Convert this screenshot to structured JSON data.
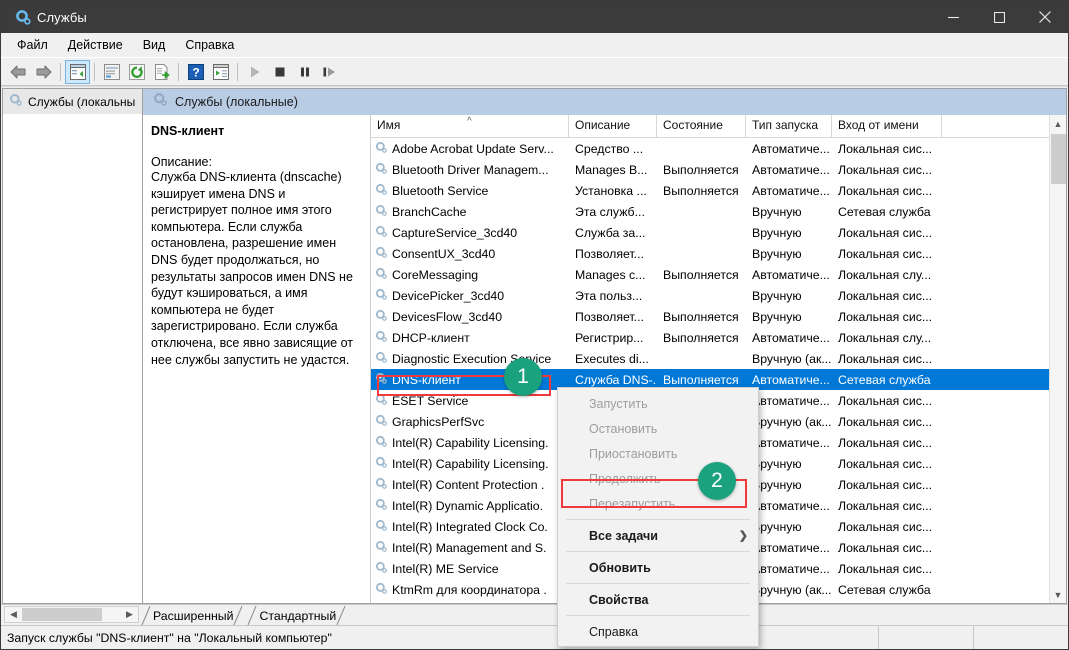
{
  "window": {
    "title": "Службы",
    "icon": "services-gear-icon",
    "controls": {
      "minimize": "minimize-icon",
      "maximize": "maximize-icon",
      "close": "close-icon"
    }
  },
  "menu": {
    "items": [
      "Файл",
      "Действие",
      "Вид",
      "Справка"
    ]
  },
  "toolbar": {
    "buttons": [
      "back-arrow-icon",
      "forward-arrow-icon",
      "show-hide-tree-icon",
      "properties-icon",
      "refresh-icon",
      "export-list-icon",
      "help-icon",
      "show-action-pane-icon",
      "start-service-icon",
      "stop-service-icon",
      "pause-service-icon",
      "restart-service-icon"
    ]
  },
  "tree": {
    "node_label": "Службы (локальны"
  },
  "content": {
    "header_title": "Службы (локальные)",
    "description_panel": {
      "service_name": "DNS-клиент",
      "label": "Описание:",
      "text": "Служба DNS-клиента (dnscache) кэширует имена DNS и регистрирует полное имя этого компьютера. Если служба остановлена, разрешение имен DNS будет продолжаться, но результаты запросов имен DNS не будут кэшироваться, а имя компьютера не будет зарегистрировано. Если служба отключена, все явно зависящие от нее службы запустить не удастся."
    }
  },
  "table": {
    "columns": [
      "Имя",
      "Описание",
      "Состояние",
      "Тип запуска",
      "Вход от имени"
    ],
    "sorted_by": "Имя",
    "sort_direction": "ascending",
    "rows": [
      {
        "name": "Adobe Acrobat Update Serv...",
        "description": "Средство ...",
        "state": "",
        "startup": "Автоматиче...",
        "logon": "Локальная сис...",
        "selected": false
      },
      {
        "name": "Bluetooth Driver Managem...",
        "description": "Manages B...",
        "state": "Выполняется",
        "startup": "Автоматиче...",
        "logon": "Локальная сис...",
        "selected": false
      },
      {
        "name": "Bluetooth Service",
        "description": "Установка ...",
        "state": "Выполняется",
        "startup": "Автоматиче...",
        "logon": "Локальная сис...",
        "selected": false
      },
      {
        "name": "BranchCache",
        "description": "Эта служб...",
        "state": "",
        "startup": "Вручную",
        "logon": "Сетевая служба",
        "selected": false
      },
      {
        "name": "CaptureService_3cd40",
        "description": "Служба за...",
        "state": "",
        "startup": "Вручную",
        "logon": "Локальная сис...",
        "selected": false
      },
      {
        "name": "ConsentUX_3cd40",
        "description": "Позволяет...",
        "state": "",
        "startup": "Вручную",
        "logon": "Локальная сис...",
        "selected": false
      },
      {
        "name": "CoreMessaging",
        "description": "Manages c...",
        "state": "Выполняется",
        "startup": "Автоматиче...",
        "logon": "Локальная слу...",
        "selected": false
      },
      {
        "name": "DevicePicker_3cd40",
        "description": "Эта польз...",
        "state": "",
        "startup": "Вручную",
        "logon": "Локальная сис...",
        "selected": false
      },
      {
        "name": "DevicesFlow_3cd40",
        "description": "Позволяет...",
        "state": "Выполняется",
        "startup": "Вручную",
        "logon": "Локальная сис...",
        "selected": false
      },
      {
        "name": "DHCP-клиент",
        "description": "Регистрир...",
        "state": "Выполняется",
        "startup": "Автоматиче...",
        "logon": "Локальная слу...",
        "selected": false
      },
      {
        "name": "Diagnostic Execution Service",
        "description": "Executes di...",
        "state": "",
        "startup": "Вручную (ак...",
        "logon": "Локальная сис...",
        "selected": false
      },
      {
        "name": "DNS-клиент",
        "description": "Служба DNS-...",
        "state": "Выполняется",
        "startup": "Автоматиче...",
        "logon": "Сетевая служба",
        "selected": true
      },
      {
        "name": "ESET Service",
        "description": "",
        "state": "",
        "startup": "Автоматиче...",
        "logon": "Локальная сис...",
        "selected": false
      },
      {
        "name": "GraphicsPerfSvc",
        "description": "",
        "state": "",
        "startup": "Вручную (ак...",
        "logon": "Локальная сис...",
        "selected": false
      },
      {
        "name": "Intel(R) Capability Licensing.",
        "description": "",
        "state": "",
        "startup": "Автоматиче...",
        "logon": "Локальная сис...",
        "selected": false
      },
      {
        "name": "Intel(R) Capability Licensing.",
        "description": "",
        "state": "",
        "startup": "Вручную",
        "logon": "Локальная сис...",
        "selected": false
      },
      {
        "name": "Intel(R) Content Protection .",
        "description": "",
        "state": "",
        "startup": "Вручную",
        "logon": "Локальная сис...",
        "selected": false
      },
      {
        "name": "Intel(R) Dynamic Applicatio.",
        "description": "",
        "state": "",
        "startup": "Автоматиче...",
        "logon": "Локальная сис...",
        "selected": false
      },
      {
        "name": "Intel(R) Integrated Clock Co.",
        "description": "",
        "state": "",
        "startup": "Вручную",
        "logon": "Локальная сис...",
        "selected": false
      },
      {
        "name": "Intel(R) Management and S.",
        "description": "",
        "state": "",
        "startup": "Автоматиче...",
        "logon": "Локальная сис...",
        "selected": false
      },
      {
        "name": "Intel(R) ME Service",
        "description": "",
        "state": "",
        "startup": "Автоматиче...",
        "logon": "Локальная сис...",
        "selected": false
      },
      {
        "name": "KtmRm для координатора .",
        "description": "",
        "state": "",
        "startup": "Вручную (ак...",
        "logon": "Сетевая служба",
        "selected": false
      }
    ]
  },
  "context_menu": {
    "items": [
      {
        "label": "Запустить",
        "disabled": true,
        "bold": false,
        "submenu": false
      },
      {
        "label": "Остановить",
        "disabled": true,
        "bold": false,
        "submenu": false
      },
      {
        "label": "Приостановить",
        "disabled": true,
        "bold": false,
        "submenu": false
      },
      {
        "label": "Продолжить",
        "disabled": true,
        "bold": false,
        "submenu": false
      },
      {
        "label": "Перезапустить",
        "disabled": true,
        "bold": false,
        "submenu": false
      },
      {
        "label": "Все задачи",
        "disabled": false,
        "bold": true,
        "submenu": true
      },
      {
        "label": "Обновить",
        "disabled": false,
        "bold": true,
        "submenu": false
      },
      {
        "label": "Свойства",
        "disabled": false,
        "bold": true,
        "submenu": false
      },
      {
        "label": "Справка",
        "disabled": false,
        "bold": false,
        "submenu": false
      }
    ]
  },
  "tabs": {
    "items": [
      "Расширенный",
      "Стандартный"
    ],
    "active": "Расширенный"
  },
  "statusbar": {
    "text": "Запуск службы \"DNS-клиент\" на \"Локальный компьютер\""
  },
  "annotations": {
    "badges": [
      {
        "number": "1",
        "target": "dns-client-row"
      },
      {
        "number": "2",
        "target": "restart-menu-item"
      }
    ],
    "highlight_color": "#ef3b3b",
    "badge_color": "#1aa17e"
  },
  "colors": {
    "titlebar": "#3b3b3b",
    "selection": "#0078d7",
    "content_header": "#b8cce4"
  }
}
